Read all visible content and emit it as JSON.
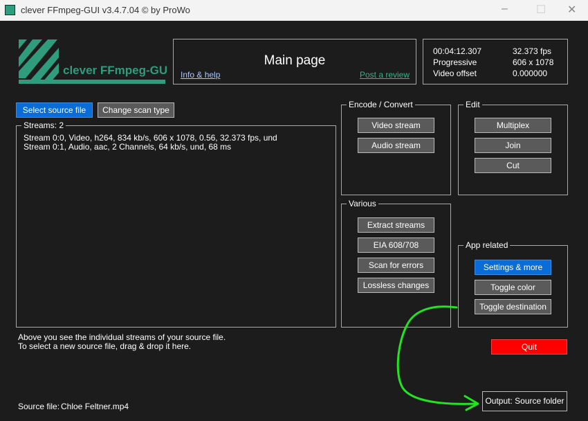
{
  "window": {
    "title": "clever FFmpeg-GUI v3.4.7.04   © by ProWo",
    "minimize": "–",
    "maximize": "☐",
    "close": "✕"
  },
  "logo": {
    "text": "clever FFmpeg-GUI",
    "color": "#2f9c7e"
  },
  "header": {
    "title": "Main page",
    "info_link": "Info & help",
    "review_link": "Post a review"
  },
  "stats": {
    "duration": "00:04:12.307",
    "fps": "32.373 fps",
    "scan": "Progressive",
    "resolution": "606 x 1078",
    "offset_label": "Video offset",
    "offset_value": "0.000000"
  },
  "toolbar": {
    "select_source": "Select source file",
    "change_scan": "Change scan type"
  },
  "streams": {
    "legend": "Streams: 2",
    "lines": [
      "Stream 0:0, Video, h264, 834 kb/s, 606 x 1078, 0.56, 32.373 fps, und",
      "Stream 0:1, Audio, aac, 2 Channels, 64 kb/s, und, 68 ms"
    ]
  },
  "encode": {
    "legend": "Encode / Convert",
    "buttons": [
      "Video stream",
      "Audio stream"
    ]
  },
  "edit": {
    "legend": "Edit",
    "buttons": [
      "Multiplex",
      "Join",
      "Cut"
    ]
  },
  "various": {
    "legend": "Various",
    "buttons": [
      "Extract streams",
      "EIA 608/708",
      "Scan for errors",
      "Lossless changes"
    ]
  },
  "app": {
    "legend": "App related",
    "buttons": [
      "Settings & more",
      "Toggle color",
      "Toggle destination"
    ]
  },
  "help": {
    "line1": "Above you see the individual streams of your source file.",
    "line2": "To select a new source file, drag & drop it here."
  },
  "quit": "Quit",
  "source": {
    "label": "Source file:",
    "value": "Chloe Feltner.mp4"
  },
  "output": "Output: Source folder",
  "colors": {
    "accent_blue": "#0a6cd6",
    "quit_red": "#ff0000",
    "annotation_green": "#22e51f"
  }
}
